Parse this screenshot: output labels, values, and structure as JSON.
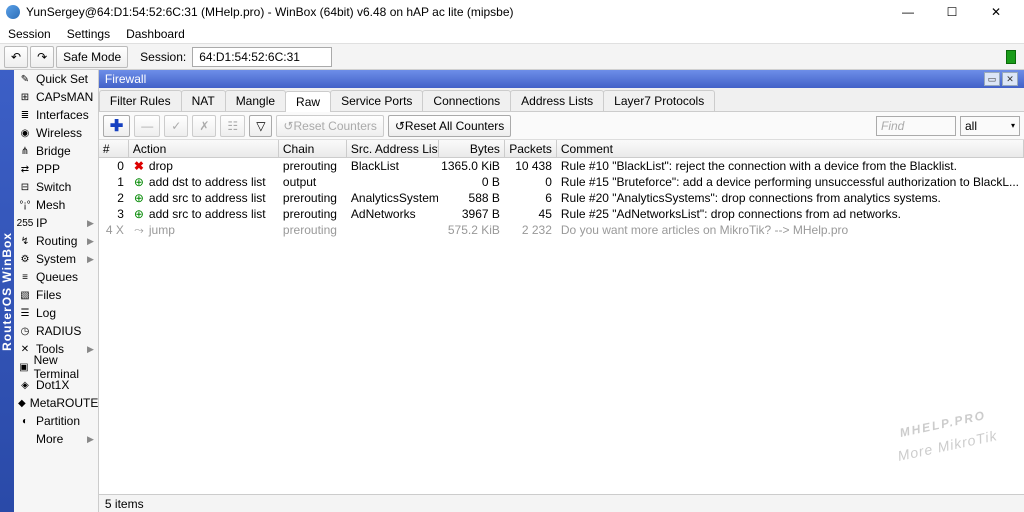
{
  "title": "YunSergey@64:D1:54:52:6C:31 (MHelp.pro) - WinBox (64bit) v6.48 on hAP ac lite (mipsbe)",
  "menubar": {
    "session": "Session",
    "settings": "Settings",
    "dashboard": "Dashboard"
  },
  "toolbar": {
    "safe_mode": "Safe Mode",
    "session_label": "Session:",
    "session_value": "64:D1:54:52:6C:31"
  },
  "rail": "RouterOS WinBox",
  "sidebar": [
    {
      "label": "Quick Set",
      "icon": "✎",
      "arrow": false
    },
    {
      "label": "CAPsMAN",
      "icon": "⊞",
      "arrow": false
    },
    {
      "label": "Interfaces",
      "icon": "≣",
      "arrow": false
    },
    {
      "label": "Wireless",
      "icon": "◉",
      "arrow": false
    },
    {
      "label": "Bridge",
      "icon": "⋔",
      "arrow": false
    },
    {
      "label": "PPP",
      "icon": "⇄",
      "arrow": false
    },
    {
      "label": "Switch",
      "icon": "⊟",
      "arrow": false
    },
    {
      "label": "Mesh",
      "icon": "°¡°",
      "arrow": false
    },
    {
      "label": "IP",
      "icon": "255",
      "arrow": true
    },
    {
      "label": "Routing",
      "icon": "↯",
      "arrow": true
    },
    {
      "label": "System",
      "icon": "⚙",
      "arrow": true
    },
    {
      "label": "Queues",
      "icon": "≡",
      "arrow": false
    },
    {
      "label": "Files",
      "icon": "▧",
      "arrow": false
    },
    {
      "label": "Log",
      "icon": "☰",
      "arrow": false
    },
    {
      "label": "RADIUS",
      "icon": "◷",
      "arrow": false
    },
    {
      "label": "Tools",
      "icon": "✕",
      "arrow": true
    },
    {
      "label": "New Terminal",
      "icon": "▣",
      "arrow": false
    },
    {
      "label": "Dot1X",
      "icon": "◈",
      "arrow": false
    },
    {
      "label": "MetaROUTER",
      "icon": "◆",
      "arrow": false
    },
    {
      "label": "Partition",
      "icon": "◐",
      "arrow": false
    },
    {
      "label": "More",
      "icon": "",
      "arrow": true
    }
  ],
  "panel": {
    "title": "Firewall",
    "tabs": [
      "Filter Rules",
      "NAT",
      "Mangle",
      "Raw",
      "Service Ports",
      "Connections",
      "Address Lists",
      "Layer7 Protocols"
    ],
    "active_tab": "Raw",
    "toolbar": {
      "reset_counters": "Reset Counters",
      "reset_all_counters": "Reset All Counters",
      "find_placeholder": "Find",
      "filter_value": "all"
    },
    "columns": {
      "idx": "#",
      "action": "Action",
      "chain": "Chain",
      "src": "Src. Address List",
      "bytes": "Bytes",
      "packets": "Packets",
      "comment": "Comment"
    },
    "rows": [
      {
        "idx": "0",
        "disabled": false,
        "icon": "drop",
        "action": "drop",
        "chain": "prerouting",
        "src": "BlackList",
        "bytes": "1365.0 KiB",
        "packets": "10 438",
        "comment": "Rule #10 \"BlackList\": reject the connection with a device from the Blacklist."
      },
      {
        "idx": "1",
        "disabled": false,
        "icon": "add",
        "action": "add dst to address list",
        "chain": "output",
        "src": "",
        "bytes": "0 B",
        "packets": "0",
        "comment": "Rule #15 \"Bruteforce\": add a device performing unsuccessful authorization to BlackL..."
      },
      {
        "idx": "2",
        "disabled": false,
        "icon": "add",
        "action": "add src to address list",
        "chain": "prerouting",
        "src": "AnalyticsSystems",
        "bytes": "588 B",
        "packets": "6",
        "comment": "Rule #20 \"AnalyticsSystems\": drop connections from analytics systems."
      },
      {
        "idx": "3",
        "disabled": false,
        "icon": "add",
        "action": "add src to address list",
        "chain": "prerouting",
        "src": "AdNetworks",
        "bytes": "3967 B",
        "packets": "45",
        "comment": "Rule #25 \"AdNetworksList\": drop connections from ad networks."
      },
      {
        "idx": "4",
        "disabled": true,
        "mark": "X",
        "icon": "jump",
        "action": "jump",
        "chain": "prerouting",
        "src": "",
        "bytes": "575.2 KiB",
        "packets": "2 232",
        "comment": "Do you want more articles on MikroTik? --> MHelp.pro"
      }
    ],
    "status": "5 items"
  },
  "watermark": {
    "main": "MHELP.PRO",
    "sub": "More MikroTik"
  }
}
